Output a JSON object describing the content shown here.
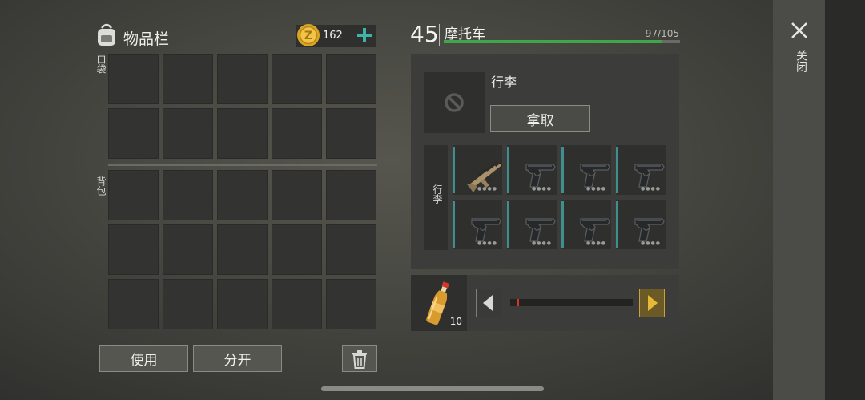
{
  "inventory": {
    "title": "物品栏",
    "coins": "162",
    "pocket_label": "口袋",
    "backpack_label": "背包",
    "use_button": "使用",
    "split_button": "分开"
  },
  "vehicle": {
    "level": "45",
    "name": "摩托车",
    "capacity_text": "97/105",
    "capacity_fraction": 0.924,
    "luggage_title": "行李",
    "take_button": "拿取",
    "trunk_label": "行李",
    "weapons": [
      "rifle-icon",
      "pistol-icon",
      "pistol-icon",
      "pistol-icon",
      "pistol-icon",
      "pistol-icon",
      "pistol-icon",
      "pistol-icon"
    ]
  },
  "fuel": {
    "item_icon": "bottle-icon",
    "count": "10",
    "slider_fraction": 0.02
  },
  "close": {
    "label": "关闭"
  },
  "colors": {
    "capacity_bar": "#3fa64a",
    "slider_accent": "#c8a23a",
    "slot_accent": "#3f8f8f"
  }
}
